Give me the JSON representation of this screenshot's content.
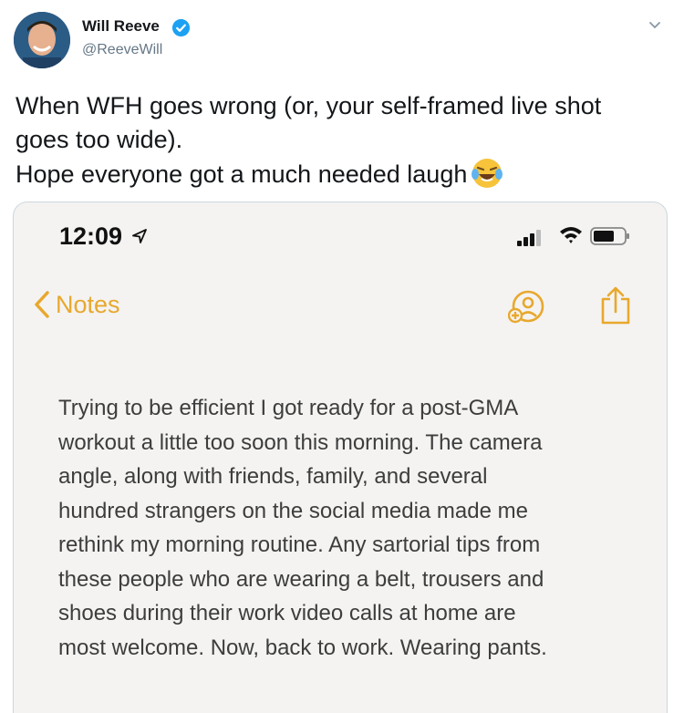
{
  "author": {
    "name": "Will Reeve",
    "handle": "@ReeveWill",
    "verified": true,
    "avatar_icon": "profile-photo"
  },
  "tweet": {
    "lines": [
      "When WFH goes wrong (or, your self-framed live shot",
      "goes too wide).",
      "Hope everyone got a much needed laugh"
    ],
    "emoji": "face-with-tears-of-joy"
  },
  "screenshot": {
    "status_bar": {
      "time": "12:09"
    },
    "nav": {
      "back_label": "Notes"
    },
    "note_lines": [
      "Trying to be efficient I got ready for a post-GMA",
      "workout a little too soon this morning. The camera",
      "angle, along with friends, family, and several",
      "hundred strangers on the social media made me",
      "rethink my morning routine. Any sartorial tips from",
      "these people who are wearing a belt, trousers and",
      "shoes during their work video calls at home are",
      "most welcome. Now, back to work. Wearing pants."
    ]
  },
  "colors": {
    "accent": "#e8a82e",
    "verified": "#1da1f2",
    "handle": "#657786"
  }
}
